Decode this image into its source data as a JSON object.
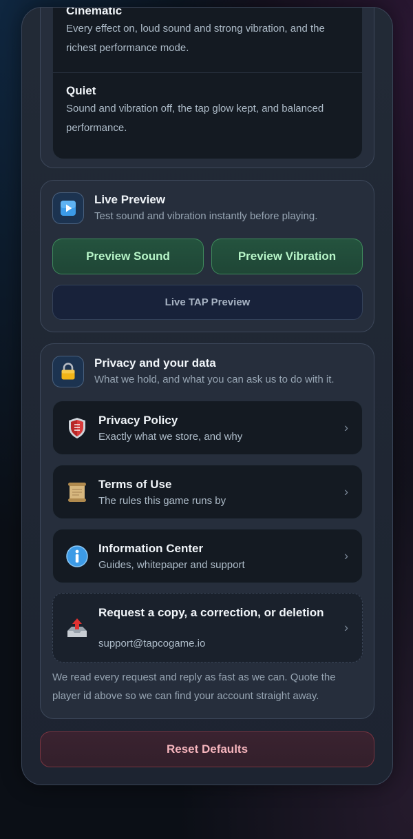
{
  "modes": [
    {
      "title": "Cinematic",
      "description": "Every effect on, loud sound and strong vibration, and the richest performance mode."
    },
    {
      "title": "Quiet",
      "description": "Sound and vibration off, the tap glow kept, and balanced performance."
    }
  ],
  "preview": {
    "title": "Live Preview",
    "subtitle": "Test sound and vibration instantly before playing.",
    "icon": "play-button-icon",
    "sound_label": "Preview Sound",
    "vibration_label": "Preview Vibration",
    "live_label": "Live TAP Preview"
  },
  "privacy": {
    "title": "Privacy and your data",
    "subtitle": "What we hold, and what you can ask us to do with it.",
    "icon": "lock-icon",
    "items": [
      {
        "title": "Privacy Policy",
        "subtitle": "Exactly what we store, and why",
        "icon": "shield-icon"
      },
      {
        "title": "Terms of Use",
        "subtitle": "The rules this game runs by",
        "icon": "scroll-icon"
      },
      {
        "title": "Information Center",
        "subtitle": "Guides, whitepaper and support",
        "icon": "info-icon"
      },
      {
        "title": "Request a copy, a correction, or deletion",
        "subtitle": "support@tapcogame.io",
        "icon": "outbox-tray-icon"
      }
    ],
    "note": "We read every request and reply as fast as we can. Quote the player id above so we can find your account straight away."
  },
  "chevron": "›",
  "reset_label": "Reset Defaults"
}
